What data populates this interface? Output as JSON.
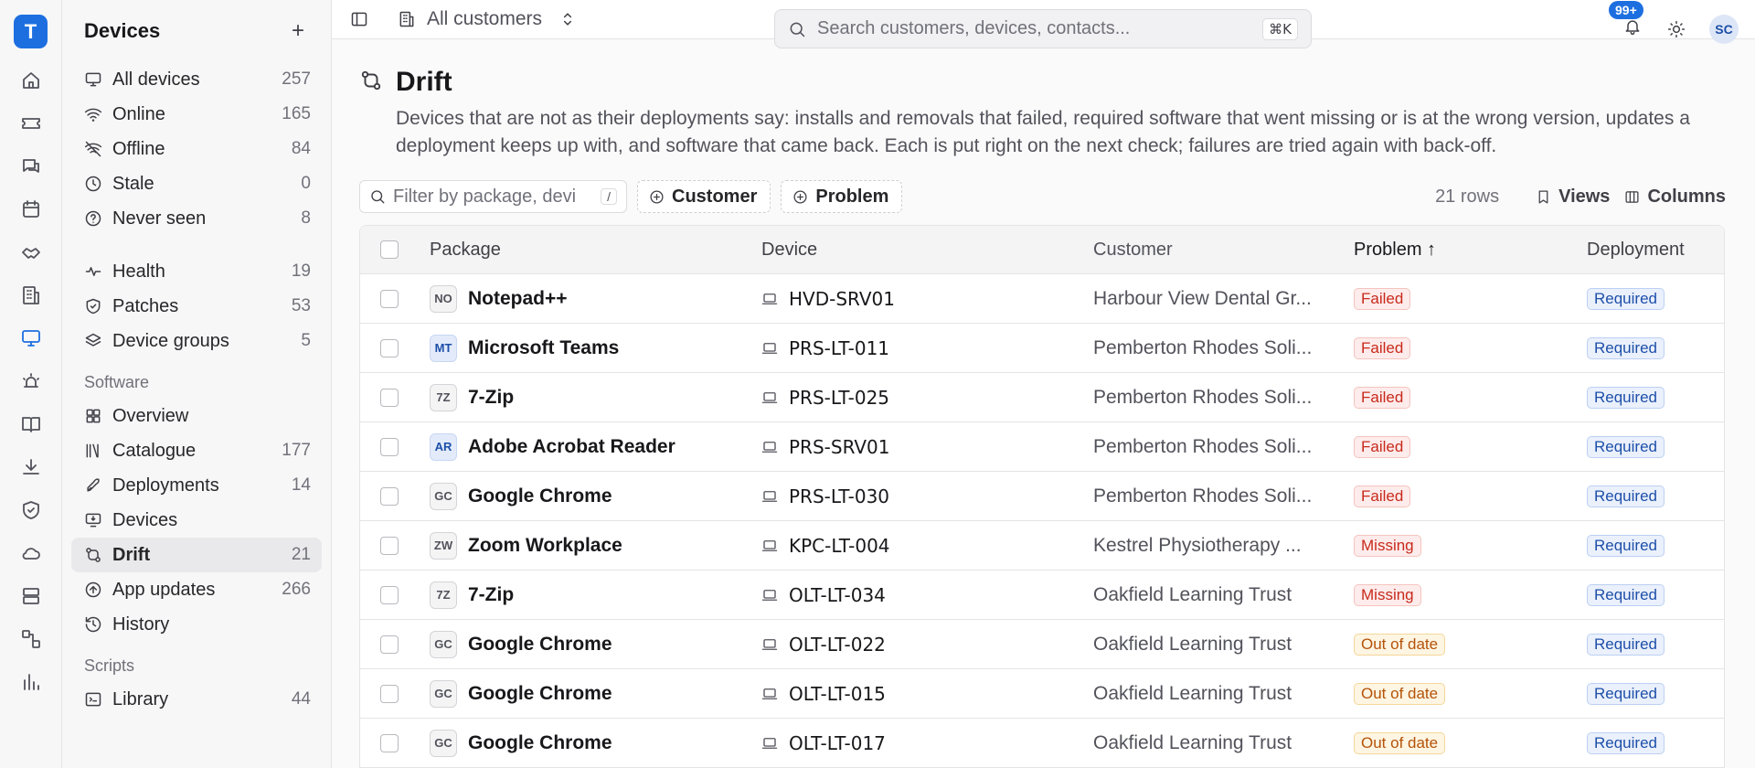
{
  "rail": {
    "logo": "T",
    "items": [
      "home-icon",
      "ticket-icon",
      "chat-icon",
      "calendar-icon",
      "handshake-icon",
      "building-icon",
      "monitor-icon",
      "alarm-icon",
      "book-icon",
      "download-icon",
      "shield-icon",
      "cloud-icon",
      "server-icon",
      "workflow-icon",
      "chart-icon"
    ]
  },
  "sidebar": {
    "title": "Devices",
    "add": "+",
    "group1": [
      {
        "label": "All devices",
        "count": "257",
        "icon": "monitor-icon"
      },
      {
        "label": "Online",
        "count": "165",
        "icon": "wifi-icon"
      },
      {
        "label": "Offline",
        "count": "84",
        "icon": "wifi-off-icon"
      },
      {
        "label": "Stale",
        "count": "0",
        "icon": "clock-icon"
      },
      {
        "label": "Never seen",
        "count": "8",
        "icon": "question-icon"
      }
    ],
    "group2": [
      {
        "label": "Health",
        "count": "19",
        "icon": "pulse-icon"
      },
      {
        "label": "Patches",
        "count": "53",
        "icon": "shield-check-icon"
      },
      {
        "label": "Device groups",
        "count": "5",
        "icon": "layers-icon"
      }
    ],
    "software_title": "Software",
    "software": [
      {
        "label": "Overview",
        "count": "",
        "icon": "grid-icon"
      },
      {
        "label": "Catalogue",
        "count": "177",
        "icon": "library-icon"
      },
      {
        "label": "Deployments",
        "count": "14",
        "icon": "rocket-icon"
      },
      {
        "label": "Devices",
        "count": "",
        "icon": "monitor-download-icon"
      },
      {
        "label": "Drift",
        "count": "21",
        "icon": "drift-icon"
      },
      {
        "label": "App updates",
        "count": "266",
        "icon": "arrow-up-circle-icon"
      },
      {
        "label": "History",
        "count": "",
        "icon": "history-icon"
      }
    ],
    "scripts_title": "Scripts",
    "scripts": [
      {
        "label": "Library",
        "count": "44",
        "icon": "code-icon"
      }
    ]
  },
  "topbar": {
    "customer": "All customers",
    "search_placeholder": "Search customers, devices, contacts...",
    "shortcut": "⌘K",
    "notifications": "99+",
    "avatar": "SC"
  },
  "page": {
    "title": "Drift",
    "description": "Devices that are not as their deployments say: installs and removals that failed, required software that went missing or is at the wrong version, updates a deployment keeps up with, and software that came back. Each is put right on the next check; failures are tried again with back-off."
  },
  "toolbar": {
    "filter_placeholder": "Filter by package, devi",
    "filter_key": "/",
    "chip_customer": "Customer",
    "chip_problem": "Problem",
    "rows": "21 rows",
    "views": "Views",
    "columns": "Columns"
  },
  "table": {
    "headers": {
      "package": "Package",
      "device": "Device",
      "customer": "Customer",
      "problem": "Problem",
      "problem_sort": "↑",
      "deployment": "Deployment"
    },
    "rows": [
      {
        "abbr": "NO",
        "package": "Notepad++",
        "device": "HVD-SRV01",
        "customer": "Harbour View Dental Gr...",
        "problem": "Failed",
        "ptype": "failed",
        "deployment": "Required",
        "blue": false
      },
      {
        "abbr": "MT",
        "package": "Microsoft Teams",
        "device": "PRS-LT-011",
        "customer": "Pemberton Rhodes Soli...",
        "problem": "Failed",
        "ptype": "failed",
        "deployment": "Required",
        "blue": true
      },
      {
        "abbr": "7Z",
        "package": "7-Zip",
        "device": "PRS-LT-025",
        "customer": "Pemberton Rhodes Soli...",
        "problem": "Failed",
        "ptype": "failed",
        "deployment": "Required",
        "blue": false
      },
      {
        "abbr": "AR",
        "package": "Adobe Acrobat Reader",
        "device": "PRS-SRV01",
        "customer": "Pemberton Rhodes Soli...",
        "problem": "Failed",
        "ptype": "failed",
        "deployment": "Required",
        "blue": true
      },
      {
        "abbr": "GC",
        "package": "Google Chrome",
        "device": "PRS-LT-030",
        "customer": "Pemberton Rhodes Soli...",
        "problem": "Failed",
        "ptype": "failed",
        "deployment": "Required",
        "blue": false
      },
      {
        "abbr": "ZW",
        "package": "Zoom Workplace",
        "device": "KPC-LT-004",
        "customer": "Kestrel Physiotherapy ...",
        "problem": "Missing",
        "ptype": "missing",
        "deployment": "Required",
        "blue": false
      },
      {
        "abbr": "7Z",
        "package": "7-Zip",
        "device": "OLT-LT-034",
        "customer": "Oakfield Learning Trust",
        "problem": "Missing",
        "ptype": "missing",
        "deployment": "Required",
        "blue": false
      },
      {
        "abbr": "GC",
        "package": "Google Chrome",
        "device": "OLT-LT-022",
        "customer": "Oakfield Learning Trust",
        "problem": "Out of date",
        "ptype": "outofdate",
        "deployment": "Required",
        "blue": false
      },
      {
        "abbr": "GC",
        "package": "Google Chrome",
        "device": "OLT-LT-015",
        "customer": "Oakfield Learning Trust",
        "problem": "Out of date",
        "ptype": "outofdate",
        "deployment": "Required",
        "blue": false
      },
      {
        "abbr": "GC",
        "package": "Google Chrome",
        "device": "OLT-LT-017",
        "customer": "Oakfield Learning Trust",
        "problem": "Out of date",
        "ptype": "outofdate",
        "deployment": "Required",
        "blue": false
      }
    ]
  }
}
